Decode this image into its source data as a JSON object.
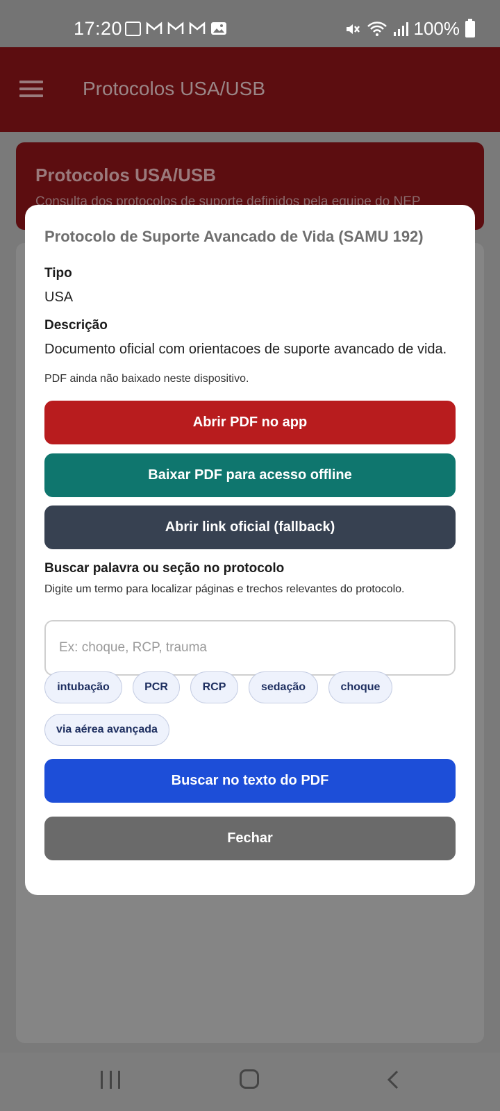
{
  "status_bar": {
    "time": "17:20",
    "battery": "100%"
  },
  "app_bar": {
    "title": "Protocolos USA/USB"
  },
  "hero": {
    "title": "Protocolos USA/USB",
    "subtitle": "Consulta dos protocolos de suporte definidos pela equipe do NEP"
  },
  "dialog": {
    "title": "Protocolo de Suporte Avancado de Vida (SAMU 192)",
    "tipo_label": "Tipo",
    "tipo_value": "USA",
    "descricao_label": "Descrição",
    "descricao_value": "Documento oficial com orientacoes de suporte avancado de vida.",
    "pdf_status": "PDF ainda não baixado neste dispositivo.",
    "btn_open_pdf": "Abrir PDF no app",
    "btn_download_pdf": "Baixar PDF para acesso offline",
    "btn_open_link": "Abrir link oficial (fallback)",
    "search_heading": "Buscar palavra ou seção no protocolo",
    "search_hint": "Digite um termo para localizar páginas e trechos relevantes do protocolo.",
    "search_value": "",
    "search_placeholder": "Ex: choque, RCP, trauma",
    "chips": [
      "intubação",
      "PCR",
      "RCP",
      "sedação",
      "choque",
      "via aérea avançada"
    ],
    "btn_search": "Buscar no texto do PDF",
    "btn_close": "Fechar"
  },
  "colors": {
    "primary_red": "#b81c1e",
    "teal": "#0f766e",
    "slate": "#374151",
    "blue": "#1d4ed8",
    "close_gray": "#6a6a6a"
  }
}
